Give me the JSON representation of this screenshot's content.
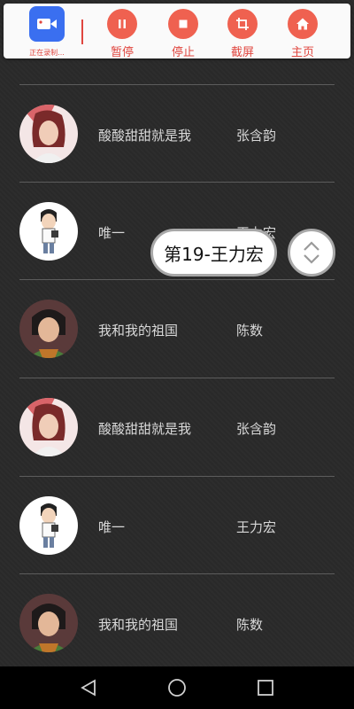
{
  "recorder": {
    "app_label": "正在录制...",
    "buttons": {
      "pause": "暂停",
      "stop": "停止",
      "screenshot": "截屏",
      "home": "主页"
    }
  },
  "list": {
    "items": [
      {
        "song": "酸酸甜甜就是我",
        "artist": "张含韵"
      },
      {
        "song": "唯一",
        "artist": "王力宏"
      },
      {
        "song": "我和我的祖国",
        "artist": "陈数"
      },
      {
        "song": "酸酸甜甜就是我",
        "artist": "张含韵"
      },
      {
        "song": "唯一",
        "artist": "王力宏"
      },
      {
        "song": "我和我的祖国",
        "artist": "陈数"
      }
    ]
  },
  "indicator": {
    "label": "第19-王力宏"
  },
  "colors": {
    "accent": "#ef6150",
    "background": "#2a2a2a",
    "text": "#d8d8d8"
  }
}
